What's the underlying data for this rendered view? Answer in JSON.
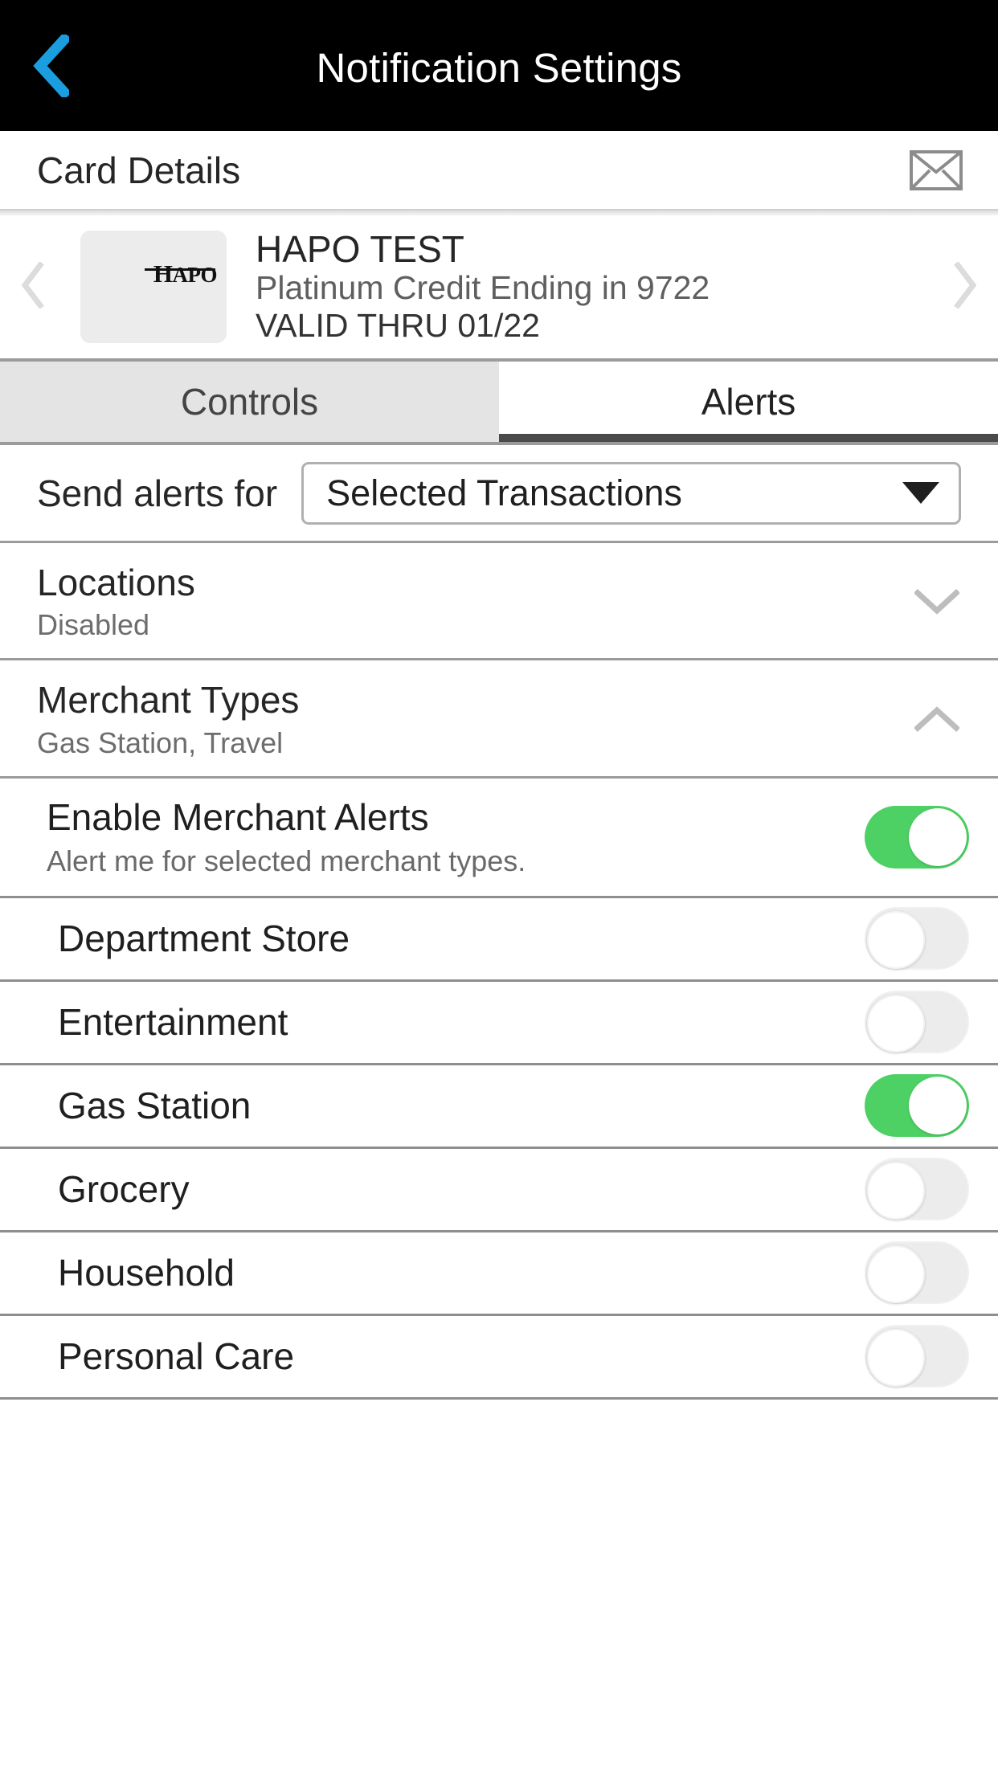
{
  "navbar": {
    "title": "Notification Settings",
    "back_icon": "chevron-left-icon",
    "back_color": "#1a9ee0",
    "background": "#000000"
  },
  "card_details": {
    "title": "Card Details",
    "mail_icon": "envelope-icon"
  },
  "card_carousel": {
    "prev_icon": "chevron-left-icon",
    "next_icon": "chevron-right-icon",
    "card_logo": "HAPO",
    "card_logo_lead": "H",
    "card_logo_rest": "APO",
    "name": "HAPO TEST",
    "type": "Platinum Credit Ending in 9722",
    "valid": "VALID THRU 01/22"
  },
  "tabs": [
    {
      "label": "Controls",
      "active": false
    },
    {
      "label": "Alerts",
      "active": true
    }
  ],
  "send_alerts": {
    "label": "Send alerts for",
    "selected": "Selected Transactions",
    "caret_icon": "caret-down-icon"
  },
  "sections": [
    {
      "title": "Locations",
      "subtitle": "Disabled",
      "expanded": false,
      "chevron_icon": "chevron-down-icon"
    },
    {
      "title": "Merchant Types",
      "subtitle": "Gas Station, Travel",
      "expanded": true,
      "chevron_icon": "chevron-up-icon"
    }
  ],
  "enable_merchant_alerts": {
    "title": "Enable Merchant Alerts",
    "subtitle": "Alert me for selected merchant types.",
    "state": "on"
  },
  "merchant_types": [
    {
      "label": "Department Store",
      "state": "off"
    },
    {
      "label": "Entertainment",
      "state": "off"
    },
    {
      "label": "Gas Station",
      "state": "on"
    },
    {
      "label": "Grocery",
      "state": "off"
    },
    {
      "label": "Household",
      "state": "off"
    },
    {
      "label": "Personal Care",
      "state": "off"
    }
  ],
  "colors": {
    "toggle_on": "#4ed164",
    "toggle_off": "#ececec",
    "accent_blue": "#1a9ee0",
    "header_bg": "#000000",
    "tab_inactive_bg": "#e4e4e4",
    "tab_underline": "#4a4a4a"
  }
}
